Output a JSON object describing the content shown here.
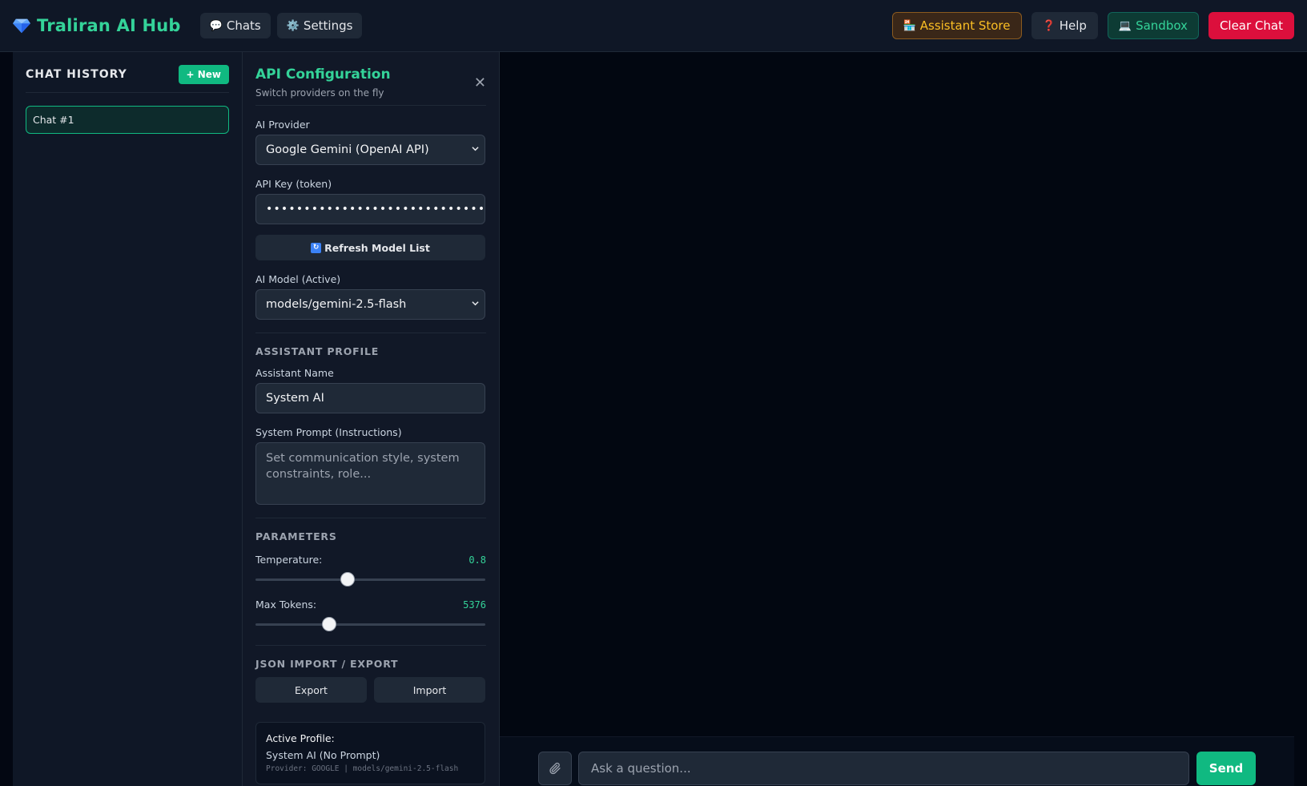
{
  "header": {
    "brand_title": "Traliran AI Hub",
    "nav": [
      {
        "label": "Chats",
        "icon": "speech-bubble-icon"
      },
      {
        "label": "Settings",
        "icon": "gear-icon"
      }
    ],
    "actions": {
      "store": "Assistant Store",
      "help": "Help",
      "sandbox": "Sandbox",
      "clear": "Clear Chat"
    }
  },
  "sidebar": {
    "title": "CHAT HISTORY",
    "new_label": "+ New",
    "items": [
      {
        "label": "Chat #1",
        "active": true
      }
    ]
  },
  "config": {
    "title": "API Configuration",
    "subtitle": "Switch providers on the fly",
    "close": "✕",
    "provider_label": "AI Provider",
    "provider_value": "Google Gemini (OpenAI API)",
    "api_key_label": "API Key (token)",
    "api_key_masked": "••••••••••••••••••••••••••••••••",
    "refresh_label": "Refresh Model List",
    "model_label": "AI Model (Active)",
    "model_value": "models/gemini-2.5-flash",
    "profile_section": "ASSISTANT PROFILE",
    "assistant_name_label": "Assistant Name",
    "assistant_name_value": "System AI",
    "system_prompt_label": "System Prompt (Instructions)",
    "system_prompt_placeholder": "Set communication style, system constraints, role...",
    "params_section": "PARAMETERS",
    "temperature_label": "Temperature:",
    "temperature_value": "0.8",
    "temperature_fraction": 0.4,
    "max_tokens_label": "Max Tokens:",
    "max_tokens_value": "5376",
    "max_tokens_fraction": 0.32,
    "io_section": "JSON IMPORT / EXPORT",
    "export_label": "Export",
    "import_label": "Import",
    "active_profile_label": "Active Profile:",
    "active_profile_name": "System AI (No Prompt)",
    "active_profile_meta": "Provider: GOOGLE | models/gemini-2.5-flash"
  },
  "composer": {
    "placeholder": "Ask a question...",
    "send_label": "Send"
  },
  "colors": {
    "accent": "#34d399",
    "accent_strong": "#10b981",
    "danger": "#dc0f3c",
    "store": "#fbbf24",
    "background": "#050b16"
  }
}
